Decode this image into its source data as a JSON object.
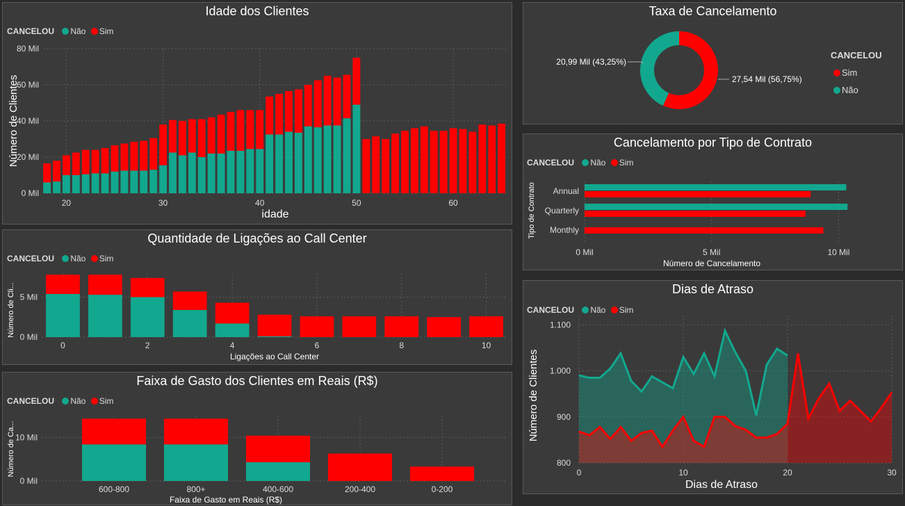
{
  "colors": {
    "nao": "#12a88f",
    "sim": "#ff0000",
    "grid": "#5c5c5c",
    "text": "#dddddd"
  },
  "legend": {
    "title": "CANCELOU",
    "nao": "Não",
    "sim": "Sim"
  },
  "age": {
    "title": "Idade dos Clientes",
    "xlabel": "idade",
    "ylabel": "Número de Clientes",
    "yticks": [
      "0 Mil",
      "20 Mil",
      "40 Mil",
      "60 Mil",
      "80 Mil"
    ],
    "xticks": [
      "20",
      "30",
      "40",
      "50",
      "60"
    ]
  },
  "calls": {
    "title": "Quantidade de Ligações ao Call Center",
    "xlabel": "Ligações ao Call Center",
    "ylabel": "Número de Cli...",
    "yticks": [
      "0 Mil",
      "5 Mil"
    ],
    "xticks": [
      "0",
      "2",
      "4",
      "6",
      "8",
      "10"
    ]
  },
  "spend": {
    "title": "Faixa de Gasto dos Clientes em Reais (R$)",
    "xlabel": "Faixa de Gasto em Reais (R$)",
    "ylabel": "Número de Ca...",
    "yticks": [
      "0 Mil",
      "10 Mil"
    ]
  },
  "cancel": {
    "title": "Taxa de Cancelamento",
    "label_nao": "20,99 Mil (43,25%)",
    "label_sim": "27,54 Mil (56,75%)"
  },
  "contract": {
    "title": "Cancelamento por Tipo de Contrato",
    "xlabel": "Número de Cancelamento",
    "ylabel": "Tipo de Contrato",
    "xticks": [
      "0 Mil",
      "5 Mil",
      "10 Mil"
    ]
  },
  "delay": {
    "title": "Dias de Atraso",
    "xlabel": "Dias de Atraso",
    "ylabel": "Número de Clientes",
    "yticks": [
      "800",
      "900",
      "1.000",
      "1.100"
    ],
    "xticks": [
      "0",
      "10",
      "20",
      "30"
    ]
  },
  "chart_data": [
    {
      "id": "age",
      "type": "bar",
      "stacked": true,
      "title": "Idade dos Clientes",
      "xlabel": "idade",
      "ylabel": "Número de Clientes",
      "ylim": [
        0,
        80000
      ],
      "x": [
        18,
        19,
        20,
        21,
        22,
        23,
        24,
        25,
        26,
        27,
        28,
        29,
        30,
        31,
        32,
        33,
        34,
        35,
        36,
        37,
        38,
        39,
        40,
        41,
        42,
        43,
        44,
        45,
        46,
        47,
        48,
        49,
        50,
        51,
        52,
        53,
        54,
        55,
        56,
        57,
        58,
        59,
        60,
        61,
        62,
        63,
        64,
        65
      ],
      "series": [
        {
          "name": "Não",
          "values": [
            6000,
            6500,
            10000,
            10000,
            10500,
            11000,
            11000,
            12000,
            12500,
            12500,
            12500,
            13000,
            15500,
            22500,
            21000,
            22500,
            20000,
            22000,
            22000,
            23500,
            23500,
            24500,
            24500,
            32500,
            32500,
            34000,
            33500,
            37000,
            36500,
            37500,
            37500,
            41500,
            49000,
            0,
            0,
            0,
            0,
            0,
            0,
            0,
            0,
            0,
            0,
            0,
            0,
            0,
            0,
            0
          ]
        },
        {
          "name": "Sim",
          "values": [
            10500,
            11500,
            11000,
            12500,
            13500,
            13000,
            14000,
            14500,
            15000,
            16000,
            16500,
            17500,
            22500,
            18000,
            19000,
            18500,
            21000,
            20000,
            21500,
            21500,
            22500,
            21500,
            21500,
            21000,
            22500,
            22500,
            24000,
            23000,
            26000,
            27500,
            26500,
            24000,
            26000,
            30000,
            31500,
            30000,
            33000,
            34500,
            36000,
            37000,
            34500,
            34500,
            36000,
            35500,
            34000,
            38000,
            37500,
            38500
          ]
        }
      ]
    },
    {
      "id": "calls",
      "type": "bar",
      "stacked": true,
      "title": "Quantidade de Ligações ao Call Center",
      "xlabel": "Ligações ao Call Center",
      "ylabel": "Número de Cli...",
      "ylim": [
        0,
        8000
      ],
      "x": [
        0,
        1,
        2,
        3,
        4,
        5,
        6,
        7,
        8,
        9,
        10
      ],
      "series": [
        {
          "name": "Não",
          "values": [
            5400,
            5300,
            5000,
            3400,
            1700,
            100,
            0,
            0,
            0,
            0,
            0
          ]
        },
        {
          "name": "Sim",
          "values": [
            2400,
            2500,
            2400,
            2300,
            2600,
            2700,
            2600,
            2600,
            2600,
            2500,
            2600
          ]
        }
      ]
    },
    {
      "id": "spend",
      "type": "bar",
      "stacked": true,
      "title": "Faixa de Gasto dos Clientes em Reais (R$)",
      "xlabel": "Faixa de Gasto em Reais (R$)",
      "ylabel": "Número de Ca...",
      "ylim": [
        0,
        15000
      ],
      "categories": [
        "600-800",
        "800+",
        "400-600",
        "200-400",
        "0-200"
      ],
      "series": [
        {
          "name": "Não",
          "values": [
            8400,
            8400,
            4300,
            0,
            0
          ]
        },
        {
          "name": "Sim",
          "values": [
            5900,
            5900,
            6100,
            6300,
            3300
          ]
        }
      ]
    },
    {
      "id": "cancel",
      "type": "pie",
      "donut": true,
      "title": "Taxa de Cancelamento",
      "categories": [
        "Sim",
        "Não"
      ],
      "values": [
        27540,
        20990
      ],
      "percent": [
        56.75,
        43.25
      ]
    },
    {
      "id": "contract",
      "type": "bar",
      "orientation": "horizontal",
      "title": "Cancelamento por Tipo de Contrato",
      "xlabel": "Número de Cancelamento",
      "ylabel": "Tipo de Contrato",
      "xlim": [
        0,
        11000
      ],
      "categories": [
        "Annual",
        "Quarterly",
        "Monthly"
      ],
      "series": [
        {
          "name": "Não",
          "values": [
            10300,
            10350,
            0
          ]
        },
        {
          "name": "Sim",
          "values": [
            8900,
            8700,
            9400
          ]
        }
      ]
    },
    {
      "id": "delay",
      "type": "area",
      "title": "Dias de Atraso",
      "xlabel": "Dias de Atraso",
      "ylabel": "Número de Clientes",
      "ylim": [
        800,
        1120
      ],
      "xlim": [
        0,
        30
      ],
      "series": [
        {
          "name": "Não",
          "x": [
            0,
            1,
            2,
            3,
            4,
            5,
            6,
            7,
            8,
            9,
            10,
            11,
            12,
            13,
            14,
            15,
            16,
            17,
            18,
            19,
            20
          ],
          "values": [
            990,
            985,
            985,
            1005,
            1038,
            978,
            955,
            988,
            975,
            962,
            1030,
            993,
            1038,
            988,
            1087,
            1040,
            1000,
            903,
            1013,
            1048,
            1033
          ]
        },
        {
          "name": "Sim",
          "x": [
            0,
            1,
            2,
            3,
            4,
            5,
            6,
            7,
            8,
            9,
            10,
            11,
            12,
            13,
            14,
            15,
            16,
            17,
            18,
            19,
            20,
            21,
            22,
            23,
            24,
            25,
            26,
            27,
            28,
            29,
            30
          ],
          "values": [
            868,
            860,
            878,
            852,
            878,
            848,
            865,
            870,
            835,
            870,
            900,
            848,
            835,
            900,
            900,
            880,
            872,
            855,
            855,
            863,
            885,
            1038,
            896,
            940,
            972,
            913,
            935,
            913,
            890,
            920,
            953
          ]
        }
      ]
    }
  ]
}
